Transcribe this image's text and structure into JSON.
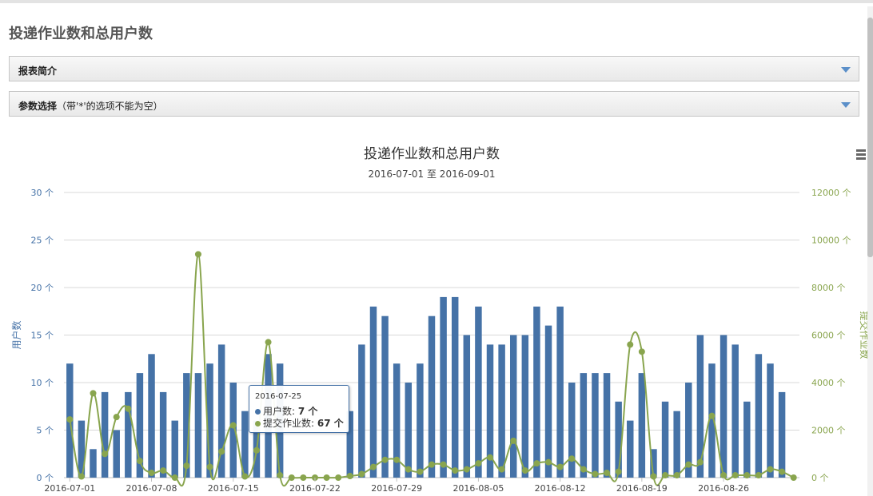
{
  "page": {
    "title": "投递作业数和总用户数",
    "panels": [
      {
        "label": "报表简介",
        "hint": ""
      },
      {
        "label": "参数选择",
        "hint": "（带'*'的选项不能为空）"
      }
    ]
  },
  "tooltip": {
    "date": "2016-07-25",
    "rows": [
      {
        "name": "用户数",
        "value": "7 个",
        "color": "#4572a7"
      },
      {
        "name": "提交作业数",
        "value": "67 个",
        "color": "#89a54e"
      }
    ]
  },
  "chart_data": {
    "type": "bar",
    "title": "投递作业数和总用户数",
    "subtitle": "2016-07-01 至 2016-09-01",
    "x": [
      "2016-07-01",
      "2016-07-02",
      "2016-07-03",
      "2016-07-04",
      "2016-07-05",
      "2016-07-06",
      "2016-07-07",
      "2016-07-08",
      "2016-07-09",
      "2016-07-10",
      "2016-07-11",
      "2016-07-12",
      "2016-07-13",
      "2016-07-14",
      "2016-07-15",
      "2016-07-16",
      "2016-07-17",
      "2016-07-18",
      "2016-07-19",
      "2016-07-20",
      "2016-07-21",
      "2016-07-22",
      "2016-07-23",
      "2016-07-24",
      "2016-07-25",
      "2016-07-26",
      "2016-07-27",
      "2016-07-28",
      "2016-07-29",
      "2016-07-30",
      "2016-07-31",
      "2016-08-01",
      "2016-08-02",
      "2016-08-03",
      "2016-08-04",
      "2016-08-05",
      "2016-08-06",
      "2016-08-07",
      "2016-08-08",
      "2016-08-09",
      "2016-08-10",
      "2016-08-11",
      "2016-08-12",
      "2016-08-13",
      "2016-08-14",
      "2016-08-15",
      "2016-08-16",
      "2016-08-17",
      "2016-08-18",
      "2016-08-19",
      "2016-08-20",
      "2016-08-21",
      "2016-08-22",
      "2016-08-23",
      "2016-08-24",
      "2016-08-25",
      "2016-08-26",
      "2016-08-27",
      "2016-08-28",
      "2016-08-29",
      "2016-08-30",
      "2016-08-31",
      "2016-09-01"
    ],
    "x_tick_labels": [
      "2016-07-01",
      "2016-07-08",
      "2016-07-15",
      "2016-07-22",
      "2016-07-29",
      "2016-08-05",
      "2016-08-12",
      "2016-08-19",
      "2016-08-26"
    ],
    "series": [
      {
        "name": "用户数",
        "type": "bar",
        "axis": "left",
        "color": "#4572a7",
        "values": [
          12,
          6,
          3,
          9,
          5,
          9,
          11,
          13,
          9,
          6,
          11,
          11,
          12,
          14,
          10,
          7,
          6,
          13,
          12,
          0,
          0,
          0,
          0,
          0,
          7,
          14,
          18,
          17,
          12,
          10,
          12,
          17,
          19,
          19,
          15,
          18,
          14,
          14,
          15,
          15,
          18,
          16,
          18,
          10,
          11,
          11,
          11,
          8,
          6,
          11,
          3,
          8,
          7,
          10,
          15,
          12,
          15,
          14,
          8,
          13,
          12,
          9,
          0
        ]
      },
      {
        "name": "提交作业数",
        "type": "spline",
        "axis": "right",
        "color": "#89a54e",
        "values": [
          2450,
          50,
          3550,
          1000,
          2550,
          2900,
          700,
          200,
          300,
          0,
          500,
          9400,
          450,
          1100,
          2200,
          50,
          1150,
          5700,
          100,
          0,
          0,
          0,
          0,
          0,
          67,
          150,
          450,
          750,
          750,
          350,
          250,
          550,
          550,
          300,
          350,
          600,
          850,
          350,
          1550,
          300,
          600,
          650,
          450,
          800,
          350,
          150,
          200,
          250,
          5600,
          5300,
          50,
          100,
          100,
          550,
          650,
          2600,
          100,
          100,
          100,
          100,
          350,
          250,
          0
        ]
      }
    ],
    "y_left": {
      "label": "用户数",
      "range": [
        0,
        30
      ],
      "ticks": [
        0,
        5,
        10,
        15,
        20,
        25,
        30
      ],
      "tick_labels": [
        "0 个",
        "5 个",
        "10 个",
        "15 个",
        "20 个",
        "25 个",
        "30 个"
      ]
    },
    "y_right": {
      "label": "提交作业数",
      "range": [
        0,
        12000
      ],
      "ticks": [
        0,
        2000,
        4000,
        6000,
        8000,
        10000,
        12000
      ],
      "tick_labels": [
        "0 个",
        "2000 个",
        "4000 个",
        "6000 个",
        "8000 个",
        "10000 个",
        "12000 个"
      ]
    },
    "grid": true,
    "legend": "none"
  }
}
